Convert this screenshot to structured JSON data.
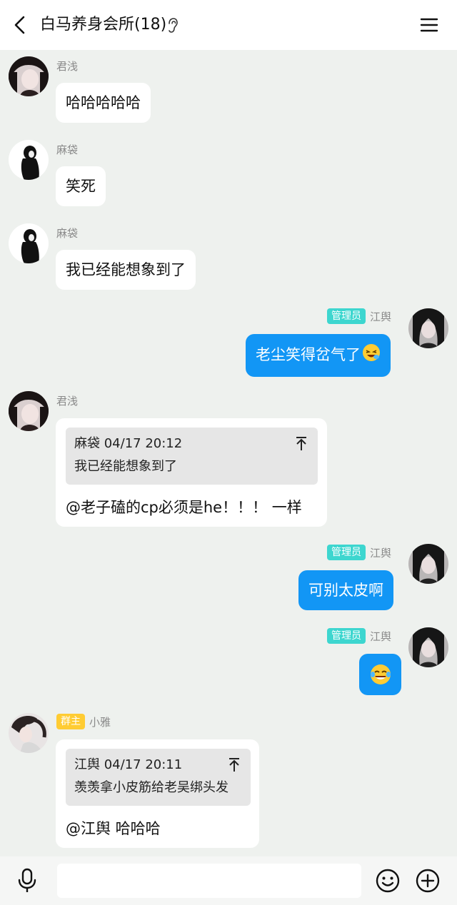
{
  "header": {
    "title": "白马养身会所(18)"
  },
  "messages": [
    {
      "sender": "君浅",
      "text": "哈哈哈哈哈"
    },
    {
      "sender": "麻袋",
      "text": "笑死"
    },
    {
      "sender": "麻袋",
      "text": "我已经能想象到了"
    },
    {
      "sender": "江舆",
      "badge": "管理员",
      "text": "老尘笑得岔气了"
    },
    {
      "sender": "君浅",
      "quote_meta": "麻袋 04/17 20:12",
      "quote_text": "我已经能想象到了",
      "text": "@老子磕的cp必须是he！！！ 一样"
    },
    {
      "sender": "江舆",
      "badge": "管理员",
      "text": "可别太皮啊"
    },
    {
      "sender": "江舆",
      "badge": "管理员",
      "emoji": "laughing-tears-emoji"
    },
    {
      "sender": "小雅",
      "badge": "群主",
      "quote_meta": "江舆 04/17 20:11",
      "quote_text": "羡羡拿小皮筋给老吴绑头发",
      "text": "@江舆 哈哈哈"
    }
  ],
  "colors": {
    "background": "#eef1ee",
    "self_bubble": "#1296f5",
    "admin_badge": "#3dd6cf",
    "owner_badge": "#ffcc33"
  },
  "icons": [
    "back-arrow-icon",
    "ear-icon",
    "menu-icon",
    "mic-icon",
    "emoji-icon",
    "plus-icon",
    "pin-top-icon"
  ]
}
